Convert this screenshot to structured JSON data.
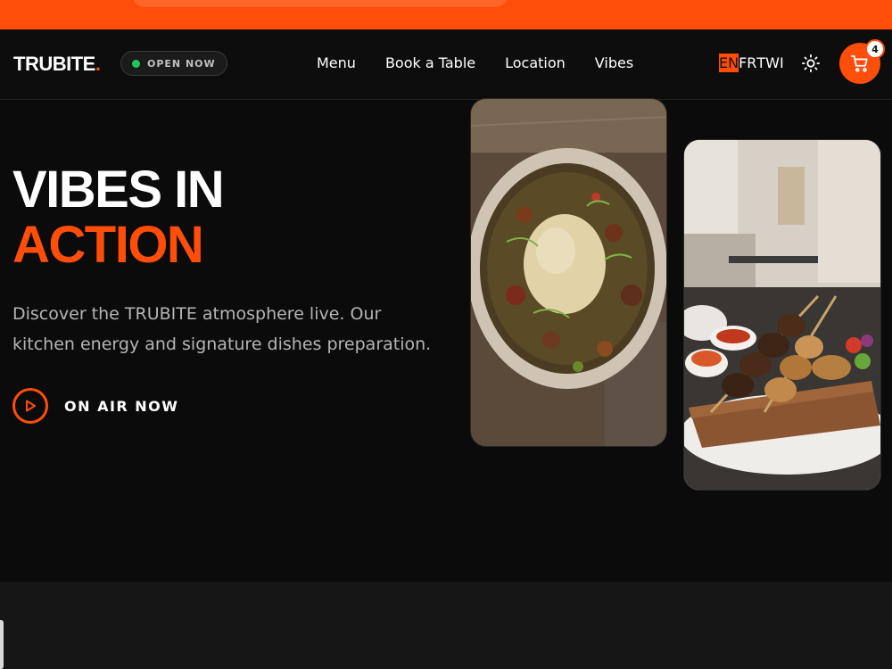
{
  "brand": {
    "name": "TRUBITE",
    "suffix": ".",
    "accent": "#ff4d0a"
  },
  "status": {
    "label": "OPEN NOW",
    "color": "#22c55e"
  },
  "nav": {
    "links": [
      {
        "label": "Menu"
      },
      {
        "label": "Book a Table"
      },
      {
        "label": "Location"
      },
      {
        "label": "Vibes"
      }
    ]
  },
  "languages": {
    "items": [
      "EN",
      "FR",
      "TWI"
    ],
    "selected": "EN"
  },
  "icons": {
    "theme": "sun-icon",
    "cart": "cart-icon",
    "play": "play-icon"
  },
  "cart": {
    "count": "4"
  },
  "hero": {
    "title_line1": "VIBES IN",
    "title_line2": "ACTION",
    "description": "Discover the TRUBITE atmosphere live. Our kitchen energy and signature dishes preparation.",
    "cta_label": "ON AIR NOW"
  }
}
